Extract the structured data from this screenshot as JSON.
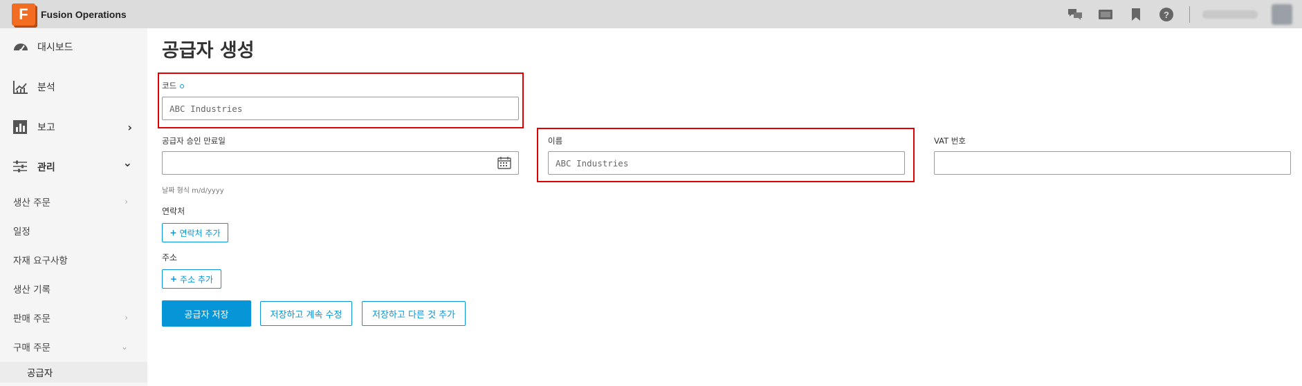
{
  "app": {
    "logo_letter": "F",
    "title": "Fusion Operations"
  },
  "topbar": {
    "icons": [
      "chat-icon",
      "media-icon",
      "bookmark-icon",
      "help-icon"
    ],
    "help_glyph": "?"
  },
  "sidebar": {
    "main_items": [
      {
        "label": "대시보드",
        "icon": "dashboard-icon"
      },
      {
        "label": "분석",
        "icon": "analytics-icon"
      },
      {
        "label": "보고",
        "icon": "report-icon",
        "chevron": "›"
      },
      {
        "label": "관리",
        "icon": "settings-sliders-icon",
        "chevron": "⌄"
      }
    ],
    "sub_items": [
      {
        "label": "생산 주문",
        "chevron": "›"
      },
      {
        "label": "일정"
      },
      {
        "label": "자재 요구사항"
      },
      {
        "label": "생산 기록"
      },
      {
        "label": "판매 주문",
        "chevron": "›"
      },
      {
        "label": "구매 주문",
        "chevron": "⌄"
      },
      {
        "label": "공급자"
      }
    ]
  },
  "form": {
    "title": "공급자 생성",
    "code": {
      "label": "코드",
      "value": "ABC Industries"
    },
    "approval_expiry": {
      "label": "공급자 승인 만료일",
      "value": "",
      "hint": "날짜 형식 m/d/yyyy"
    },
    "name": {
      "label": "이름",
      "value": "ABC Industries"
    },
    "vat": {
      "label": "VAT 번호",
      "value": ""
    },
    "contacts": {
      "label": "연락처",
      "add_button": "연락처 추가"
    },
    "address": {
      "label": "주소",
      "add_button": "주소 추가"
    },
    "buttons": {
      "save": "공급자 저장",
      "save_continue": "저장하고 계속 수정",
      "save_add_another": "저장하고 다른 것 추가"
    }
  },
  "colors": {
    "accent": "#0696d7",
    "highlight": "#e00000",
    "logo": "#f26c22"
  }
}
